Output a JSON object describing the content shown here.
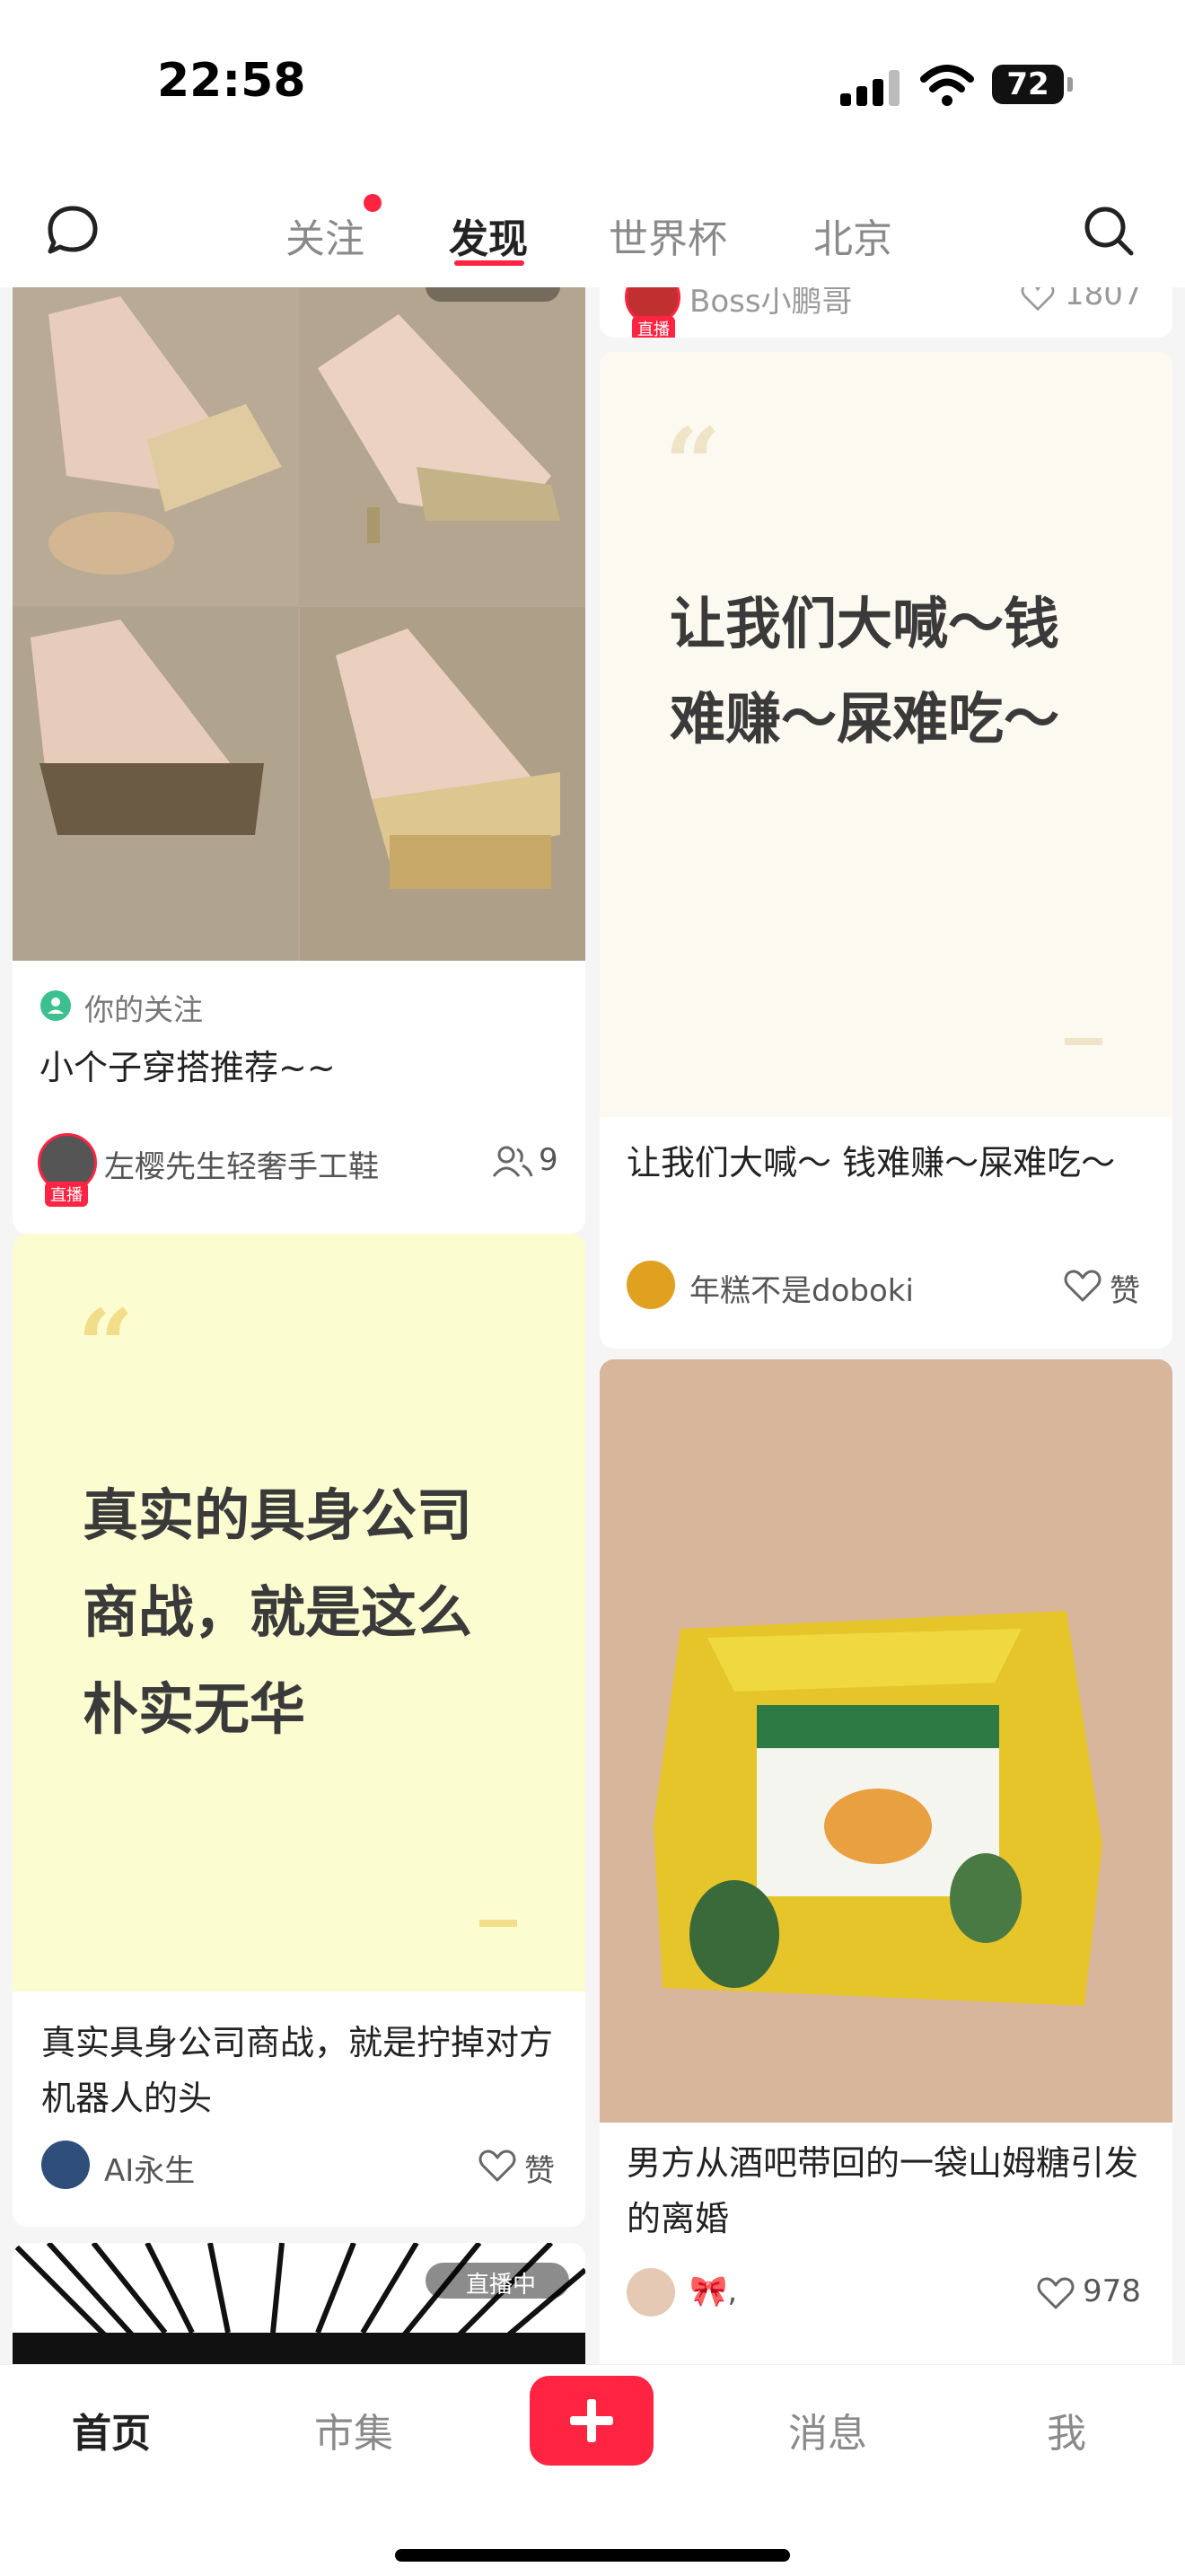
{
  "status_bar": {
    "time": "22:58",
    "battery": "72"
  },
  "nav": {
    "tabs": [
      {
        "label": "关注",
        "active": false,
        "has_dot": true
      },
      {
        "label": "发现",
        "active": true
      },
      {
        "label": "世界杯",
        "active": false
      },
      {
        "label": "北京",
        "active": false
      }
    ]
  },
  "feed": {
    "left": [
      {
        "type": "image",
        "image_desc": "shoes-collage",
        "follow_tag": "你的关注",
        "title": "小个子穿搭推荐~~",
        "author": "左樱先生轻奢手工鞋",
        "live_badge": "直播",
        "stat": "9",
        "stat_icon": "people-icon"
      },
      {
        "type": "quote",
        "quote_text": "真实的具身公司商战，就是这么朴实无华",
        "title": "真实具身公司商战，就是拧掉对方机器人的头",
        "author": "AI永生",
        "stat": "赞",
        "stat_icon": "heart-icon",
        "bg": "#fbfcd0"
      },
      {
        "type": "image",
        "image_desc": "manga-banner",
        "overlay_label": "直播中"
      }
    ],
    "right": [
      {
        "type": "partial",
        "author": "Boss小鹏哥",
        "live_badge": "直播",
        "stat": "1807",
        "stat_icon": "heart-icon"
      },
      {
        "type": "quote",
        "quote_text": "让我们大喊～钱难赚～屎难吃～",
        "title": "让我们大喊～ 钱难赚～屎难吃～",
        "author": "年糕不是doboki",
        "stat": "赞",
        "stat_icon": "heart-icon",
        "bg": "#fcfaf0"
      },
      {
        "type": "image",
        "image_desc": "ricola-candy-bag",
        "title": "男方从酒吧带回的一袋山姆糖引发的离婚",
        "author": "🎀,",
        "stat": "978",
        "stat_icon": "heart-icon"
      }
    ]
  },
  "bottom_tabs": [
    {
      "label": "首页",
      "active": true
    },
    {
      "label": "市集",
      "active": false
    },
    {
      "label": "消息",
      "active": false
    },
    {
      "label": "我",
      "active": false
    }
  ],
  "colors": {
    "accent": "#ff2442"
  }
}
